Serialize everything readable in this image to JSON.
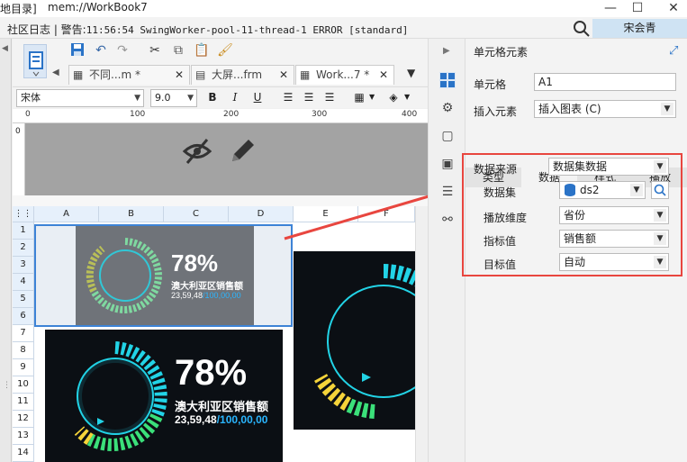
{
  "window": {
    "left_fragment": "地目录]",
    "title": "mem://WorkBook7",
    "minimize": "—",
    "maximize": "☐",
    "close": "✕"
  },
  "statusbar": {
    "prefix": "社区日志 | 警告:",
    "log": "11:56:54 SwingWorker-pool-11-thread-1 ERROR [standard]",
    "user": "宋会青"
  },
  "tabs": [
    {
      "label": "不同...m *",
      "close": "✕"
    },
    {
      "label": "大屏...frm",
      "close": "✕"
    },
    {
      "label": "Work...7 *",
      "close": "✕"
    }
  ],
  "format": {
    "font": "宋体",
    "size": "9.0",
    "bold": "B",
    "italic": "I",
    "underline": "U"
  },
  "ruler": {
    "marks": [
      "0",
      "100",
      "200",
      "300",
      "400"
    ]
  },
  "grid": {
    "columns": [
      "A",
      "B",
      "C",
      "D",
      "E",
      "F"
    ],
    "rows": [
      "1",
      "2",
      "3",
      "4",
      "5",
      "6",
      "7",
      "8",
      "9",
      "10",
      "11",
      "12",
      "13",
      "14"
    ]
  },
  "dashboard": {
    "percent": "78%",
    "label": "澳大利亚区销售额",
    "value_prefix": "23,59,48",
    "value_suffix": "/100,00,00"
  },
  "panel": {
    "title": "单元格元素",
    "cell_label": "单元格",
    "cell_value": "A1",
    "insert_label": "插入元素",
    "insert_value": "插入图表 (C)",
    "tabs": [
      "类型",
      "数据",
      "样式",
      "播放"
    ],
    "source_label": "数据来源",
    "source_value": "数据集数据",
    "dataset_label": "数据集",
    "dataset_value": "ds2",
    "dimension_label": "播放维度",
    "dimension_value": "省份",
    "metric_label": "指标值",
    "metric_value": "销售额",
    "target_label": "目标值",
    "target_value": "自动"
  },
  "colors": {
    "accent": "#2a73c7",
    "highlight_red": "#e8463f",
    "gauge_cyan": "#22d3e6",
    "gauge_yellow": "#f5d43a",
    "gauge_green": "#3be07a"
  }
}
